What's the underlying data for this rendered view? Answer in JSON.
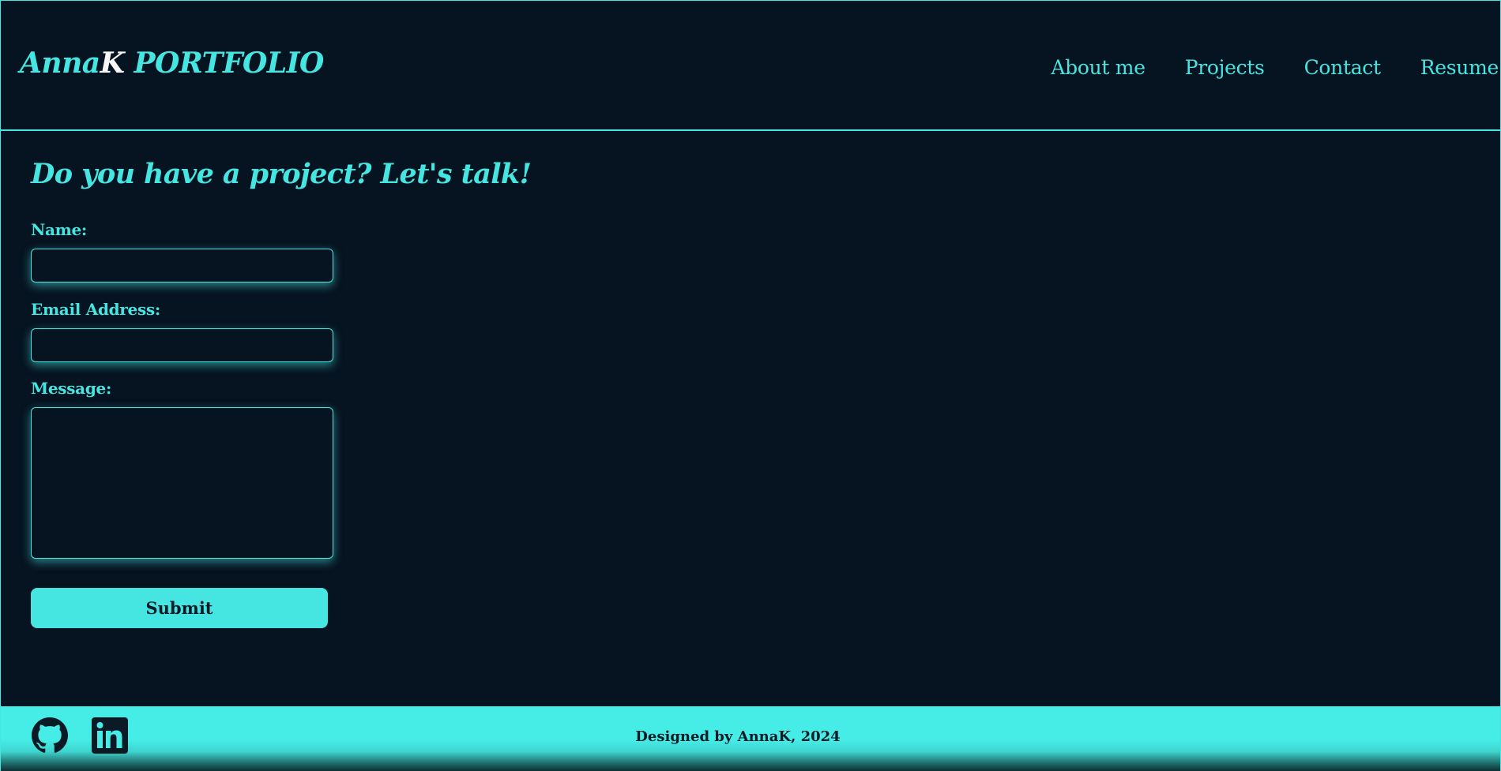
{
  "header": {
    "logo_name": "Anna",
    "logo_accent": "K",
    "logo_suffix": " PORTFOLIO",
    "nav": [
      {
        "label": "About me"
      },
      {
        "label": "Projects"
      },
      {
        "label": "Contact"
      },
      {
        "label": "Resume"
      }
    ]
  },
  "contact": {
    "heading": "Do you have a project? Let's talk!",
    "name_label": "Name:",
    "name_value": "",
    "email_label": "Email Address:",
    "email_value": "",
    "message_label": "Message:",
    "message_value": "",
    "submit_label": "Submit"
  },
  "footer": {
    "credit": "Designed by AnnaK, 2024",
    "social": [
      {
        "icon": "github-icon"
      },
      {
        "icon": "linkedin-icon"
      }
    ]
  },
  "colors": {
    "background": "#061320",
    "accent": "#45e6e2",
    "logo_accent": "#f6f6f6",
    "footer_text": "#0b1b26"
  }
}
